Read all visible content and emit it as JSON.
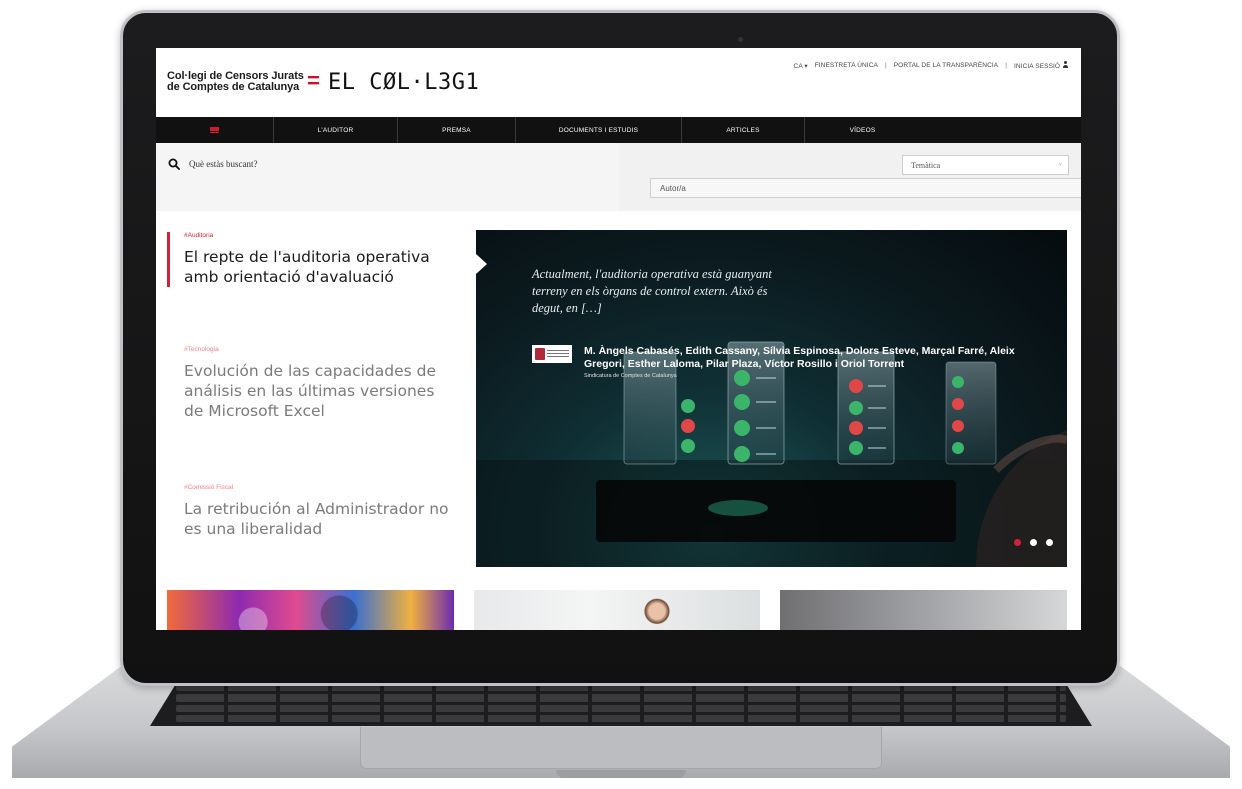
{
  "site": {
    "org_line1": "Col·legi de Censors Jurats",
    "org_line2": "de Comptes de Catalunya",
    "logo_symbol": "=",
    "logo_mark": "EL CØL·L3G1"
  },
  "top_links": {
    "language": "CA",
    "language_chevron": "▾",
    "finestreta": "FINESTRETA ÚNICA",
    "separator": "|",
    "portal": "PORTAL DE LA TRANSPARÈNCIA",
    "login": "INICIA SESSIÓ"
  },
  "nav": {
    "items": [
      {
        "label": "L'AUDITOR"
      },
      {
        "label": "PREMSA"
      },
      {
        "label": "DOCUMENTS I ESTUDIS"
      },
      {
        "label": "ARTICLES"
      },
      {
        "label": "VÍDEOS"
      }
    ]
  },
  "search": {
    "placeholder": "Què estàs buscant?",
    "tematica_label": "Temàtica",
    "tematica_chevron": "˅",
    "autor_placeholder": "Autor/a"
  },
  "articles": [
    {
      "tag": "#Auditoria",
      "title": "El repte de l'auditoria operativa amb orientació d'avaluació"
    },
    {
      "tag": "#Tecnologia",
      "title": "Evolución de las capacidades de análisis en las últimas versiones de Microsoft Excel"
    },
    {
      "tag": "#Comissió Fiscal",
      "title": "La retribución al Administrador no es una liberalidad"
    }
  ],
  "hero": {
    "quote": "Actualment, l'auditoria operativa està guanyant terreny en els òrgans de control extern. Això és degut, en […]",
    "authors": "M. Àngels Cabasés, Edith Cassany, Sílvia Espinosa, Dolors Esteve, Marçal Farré, Aleix Gregori, Esther Laloma, Pilar Plaza, Víctor Rosillo i Oriol Torrent",
    "organization": "Sindicatura de Comptes de Catalunya",
    "slides_total": 3,
    "active_slide": 1
  },
  "colors": {
    "accent": "#d3213a",
    "nav_background": "#111111",
    "search_background": "#f1f1f2"
  },
  "icons": [
    "search-icon",
    "user-icon",
    "hamburger-menu-icon",
    "chevron-down-icon"
  ]
}
